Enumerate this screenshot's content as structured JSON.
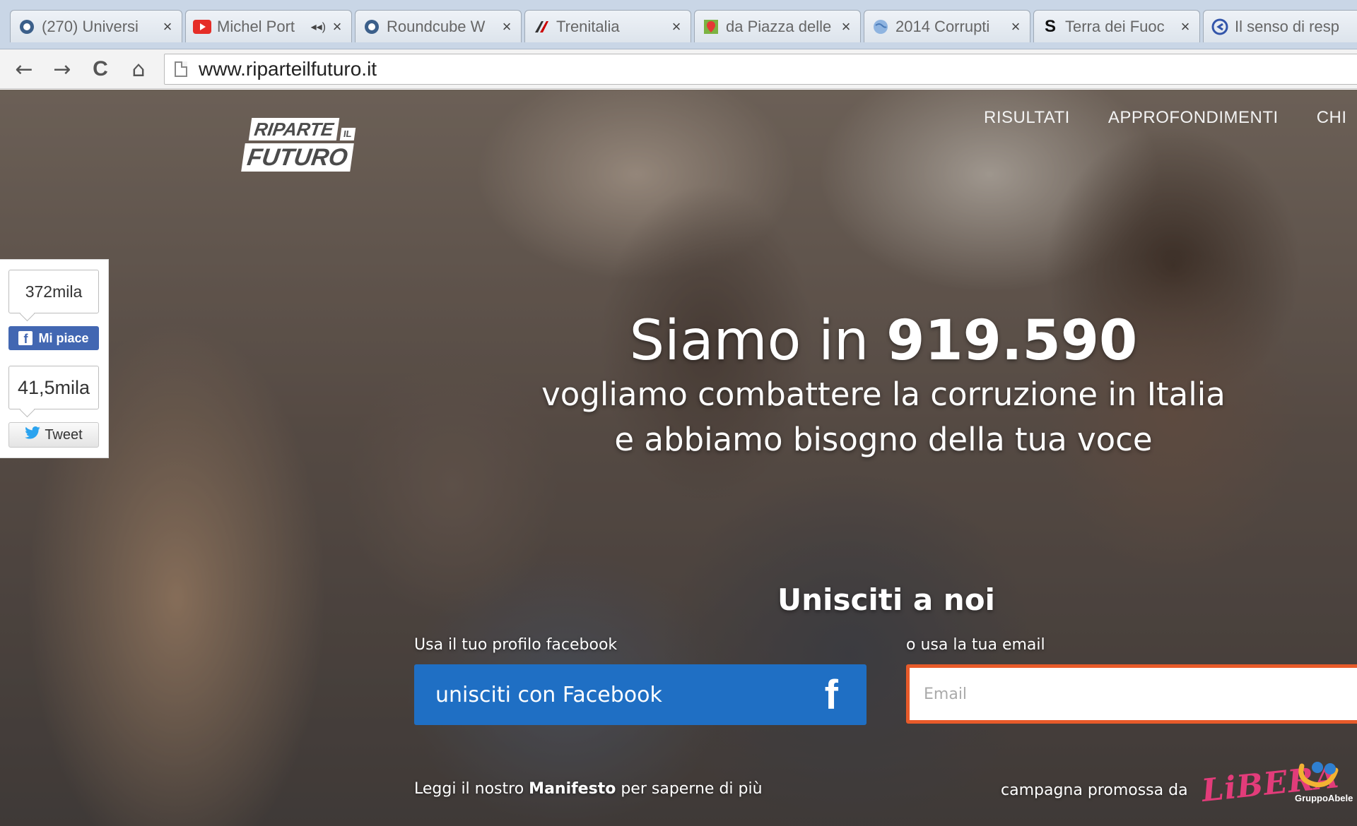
{
  "browser": {
    "tabs": [
      {
        "title": "(270) Universi",
        "icon": "roundcube-icon",
        "close": "×"
      },
      {
        "title": "Michel Port",
        "icon": "youtube-icon",
        "close": "×",
        "audio": "◂◂)"
      },
      {
        "title": "Roundcube W",
        "icon": "roundcube-icon",
        "close": "×"
      },
      {
        "title": "Trenitalia",
        "icon": "trenitalia-icon",
        "close": "×"
      },
      {
        "title": "da Piazza delle",
        "icon": "google-maps-icon",
        "close": "×"
      },
      {
        "title": "2014 Corrupti",
        "icon": "globe-icon",
        "close": "×"
      },
      {
        "title": "Terra dei Fuoc",
        "icon": "s-icon",
        "close": "×"
      },
      {
        "title": "Il senso di resp",
        "icon": "c-icon",
        "close": "×"
      }
    ],
    "url": "www.riparteilfuturo.it",
    "nav_icons": {
      "back": "←",
      "forward": "→",
      "reload": "C",
      "home": "⌂"
    }
  },
  "page": {
    "logo": {
      "line1": "RIPARTE",
      "il": "IL",
      "line2": "FUTURO"
    },
    "nav": [
      "RISULTATI",
      "APPROFONDIMENTI",
      "CHI"
    ],
    "social": {
      "fb_count": "372mila",
      "fb_label": "Mi piace",
      "tw_count": "41,5mila",
      "tw_label": "Tweet"
    },
    "headline_prefix": "Siamo in ",
    "headline_number": "919.590",
    "subline1": "vogliamo combattere la corruzione in Italia",
    "subline2": "e abbiamo bisogno della tua voce",
    "join_title": "Unisciti a noi",
    "fb_label_small": "Usa il tuo profilo facebook",
    "email_label_small": "o usa la tua email",
    "fb_button": "unisciti con Facebook",
    "email_placeholder": "Email",
    "manifesto_prefix": "Leggi il nostro ",
    "manifesto_bold": "Manifesto",
    "manifesto_suffix": " per saperne di più",
    "promo_text": "campagna promossa da",
    "libera": "LiBERA",
    "gruppo_abele": "GruppoAbele"
  },
  "colors": {
    "fb_blue": "#1f6fc4",
    "email_border": "#e85b2a",
    "libera_pink": "#e23c7a"
  }
}
